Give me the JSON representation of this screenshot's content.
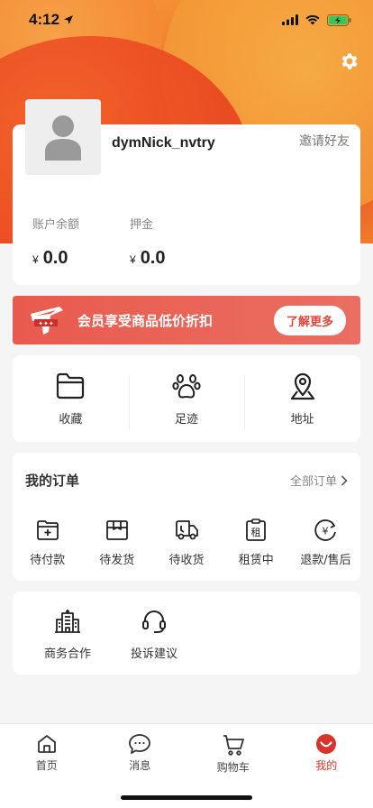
{
  "status_bar": {
    "time": "4:12"
  },
  "profile": {
    "username": "dymNick_nvtry",
    "invite_label": "邀请好友",
    "balance": {
      "label": "账户余额",
      "currency": "¥",
      "value": "0.0"
    },
    "deposit": {
      "label": "押金",
      "currency": "¥",
      "value": "0.0"
    }
  },
  "member_banner": {
    "text": "会员享受商品低价折扣",
    "button_label": "了解更多"
  },
  "quick_actions": [
    {
      "label": "收藏",
      "icon": "folder-icon"
    },
    {
      "label": "足迹",
      "icon": "paw-icon"
    },
    {
      "label": "地址",
      "icon": "location-icon"
    }
  ],
  "orders": {
    "title": "我的订单",
    "all_label": "全部订单",
    "items": [
      {
        "label": "待付款",
        "icon": "wallet-icon"
      },
      {
        "label": "待发货",
        "icon": "package-icon"
      },
      {
        "label": "待收货",
        "icon": "truck-icon"
      },
      {
        "label": "租赁中",
        "icon": "rent-icon",
        "glyph": "租"
      },
      {
        "label": "退款/售后",
        "icon": "refund-icon",
        "glyph": "¥"
      }
    ]
  },
  "services": [
    {
      "label": "商务合作",
      "icon": "building-icon"
    },
    {
      "label": "投诉建议",
      "icon": "headset-icon"
    }
  ],
  "tab_bar": {
    "tabs": [
      {
        "label": "首页",
        "icon": "home-icon"
      },
      {
        "label": "消息",
        "icon": "message-icon"
      },
      {
        "label": "购物车",
        "icon": "cart-icon"
      },
      {
        "label": "我的",
        "icon": "profile-icon",
        "active": true
      }
    ]
  },
  "colors": {
    "accent": "#d9342b",
    "banner": "#e95a4e",
    "header_orange": "#f07a2a"
  }
}
